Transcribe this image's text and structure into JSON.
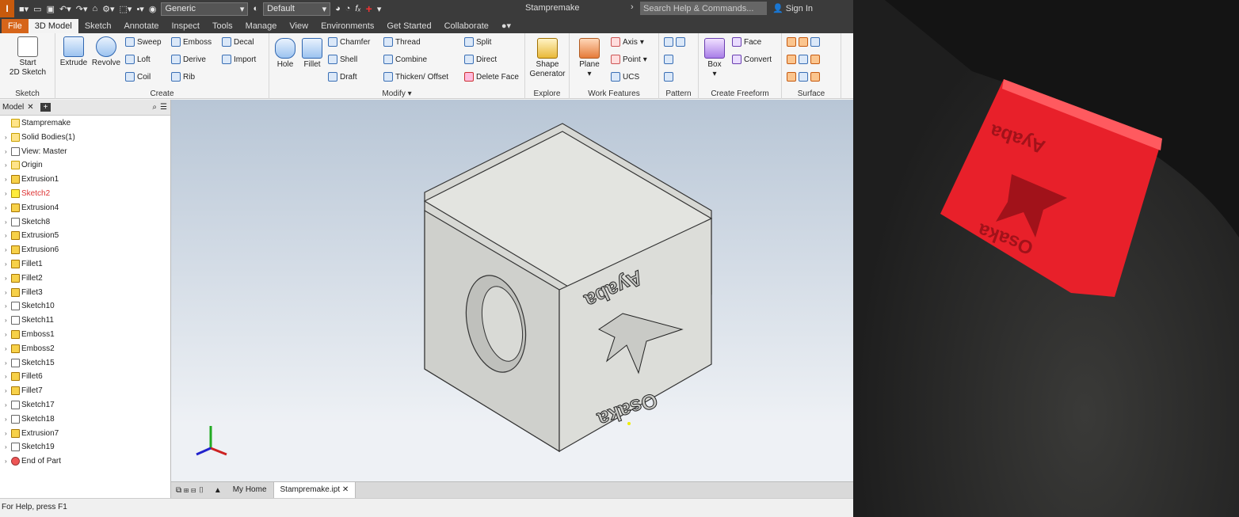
{
  "app": {
    "logo": "I",
    "title": "Stampremake",
    "search_placeholder": "Search Help & Commands...",
    "sign_in": "Sign In",
    "material": "Generic",
    "appearance": "Default"
  },
  "tabs": [
    "File",
    "3D Model",
    "Sketch",
    "Annotate",
    "Inspect",
    "Tools",
    "Manage",
    "View",
    "Environments",
    "Get Started",
    "Collaborate"
  ],
  "ribbon": {
    "sketch_panel": {
      "label": "Sketch",
      "start": "Start",
      "start2": "2D Sketch"
    },
    "create_panel": {
      "label": "Create",
      "extrude": "Extrude",
      "revolve": "Revolve",
      "sweep": "Sweep",
      "loft": "Loft",
      "coil": "Coil",
      "emboss": "Emboss",
      "derive": "Derive",
      "rib": "Rib",
      "decal": "Decal",
      "import": "Import"
    },
    "modify_panel": {
      "label": "Modify",
      "hole": "Hole",
      "fillet": "Fillet",
      "chamfer": "Chamfer",
      "shell": "Shell",
      "draft": "Draft",
      "thread": "Thread",
      "combine": "Combine",
      "thicken": "Thicken/ Offset",
      "split": "Split",
      "direct": "Direct",
      "delete_face": "Delete Face"
    },
    "explore_panel": {
      "label": "Explore",
      "shape1": "Shape",
      "shape2": "Generator"
    },
    "work_panel": {
      "label": "Work Features",
      "plane": "Plane",
      "axis": "Axis",
      "point": "Point",
      "ucs": "UCS"
    },
    "pattern_panel": {
      "label": "Pattern"
    },
    "freeform_panel": {
      "label": "Create Freeform",
      "box": "Box",
      "face": "Face",
      "convert": "Convert"
    },
    "surface_panel": {
      "label": "Surface"
    }
  },
  "browser": {
    "tab": "Model",
    "items": [
      {
        "label": "Stampremake",
        "icon": "part"
      },
      {
        "label": "Solid Bodies(1)",
        "icon": "folder"
      },
      {
        "label": "View: Master",
        "icon": "view"
      },
      {
        "label": "Origin",
        "icon": "folder"
      },
      {
        "label": "Extrusion1",
        "icon": "feature"
      },
      {
        "label": "Sketch2",
        "icon": "warning"
      },
      {
        "label": "Extrusion4",
        "icon": "feature"
      },
      {
        "label": "Sketch8",
        "icon": "sketch"
      },
      {
        "label": "Extrusion5",
        "icon": "feature"
      },
      {
        "label": "Extrusion6",
        "icon": "feature"
      },
      {
        "label": "Fillet1",
        "icon": "feature"
      },
      {
        "label": "Fillet2",
        "icon": "feature"
      },
      {
        "label": "Fillet3",
        "icon": "feature"
      },
      {
        "label": "Sketch10",
        "icon": "sketch"
      },
      {
        "label": "Sketch11",
        "icon": "sketch"
      },
      {
        "label": "Emboss1",
        "icon": "feature"
      },
      {
        "label": "Emboss2",
        "icon": "feature"
      },
      {
        "label": "Sketch15",
        "icon": "sketch"
      },
      {
        "label": "Fillet6",
        "icon": "feature"
      },
      {
        "label": "Fillet7",
        "icon": "feature"
      },
      {
        "label": "Sketch17",
        "icon": "sketch"
      },
      {
        "label": "Sketch18",
        "icon": "sketch"
      },
      {
        "label": "Extrusion7",
        "icon": "feature"
      },
      {
        "label": "Sketch19",
        "icon": "sketch"
      },
      {
        "label": "End of Part",
        "icon": "end"
      }
    ]
  },
  "viewport": {
    "top_text": "Ayaba",
    "bottom_text": "Osaka"
  },
  "doc_tabs": {
    "home": "My Home",
    "file": "Stampremake.ipt"
  },
  "status": "For Help, press F1",
  "colors": {
    "accent": "#d6651a",
    "stamp": "#e8202a"
  }
}
